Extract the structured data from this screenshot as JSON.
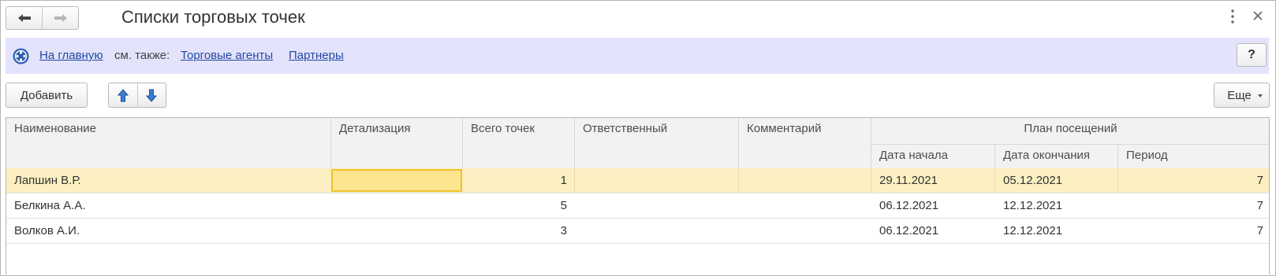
{
  "window": {
    "title": "Списки торговых точек",
    "nav": {
      "back_icon": "arrow-left-icon",
      "forward_icon": "arrow-right-icon"
    },
    "more_icon": "vertical-dots-icon",
    "close_icon": "close-icon"
  },
  "infobar": {
    "home_link": "На главную",
    "see_also": "см. также:",
    "links": [
      "Торговые агенты",
      "Партнеры"
    ],
    "help": "?"
  },
  "toolbar": {
    "add_label": "Добавить",
    "move_up_icon": "arrow-up-icon",
    "move_down_icon": "arrow-down-icon",
    "more_label": "Еще"
  },
  "table": {
    "columns": {
      "name": "Наименование",
      "detail": "Детализация",
      "total": "Всего точек",
      "responsible": "Ответственный",
      "comment": "Комментарий",
      "plan": "План посещений",
      "start": "Дата начала",
      "end": "Дата окончания",
      "period": "Период"
    },
    "rows": [
      {
        "name": "Лапшин В.Р.",
        "detail": "",
        "total": "1",
        "responsible": "",
        "comment": "",
        "start": "29.11.2021",
        "end": "05.12.2021",
        "period": "7"
      },
      {
        "name": "Белкина А.А.",
        "detail": "",
        "total": "5",
        "responsible": "",
        "comment": "",
        "start": "06.12.2021",
        "end": "12.12.2021",
        "period": "7"
      },
      {
        "name": "Волков А.И.",
        "detail": "",
        "total": "3",
        "responsible": "",
        "comment": "",
        "start": "06.12.2021",
        "end": "12.12.2021",
        "period": "7"
      }
    ]
  },
  "colors": {
    "accent_link": "#2347a3",
    "infobar_bg": "#e3e3fb",
    "selected_row": "#fcf0c2",
    "focus_cell": "#fde48f"
  }
}
